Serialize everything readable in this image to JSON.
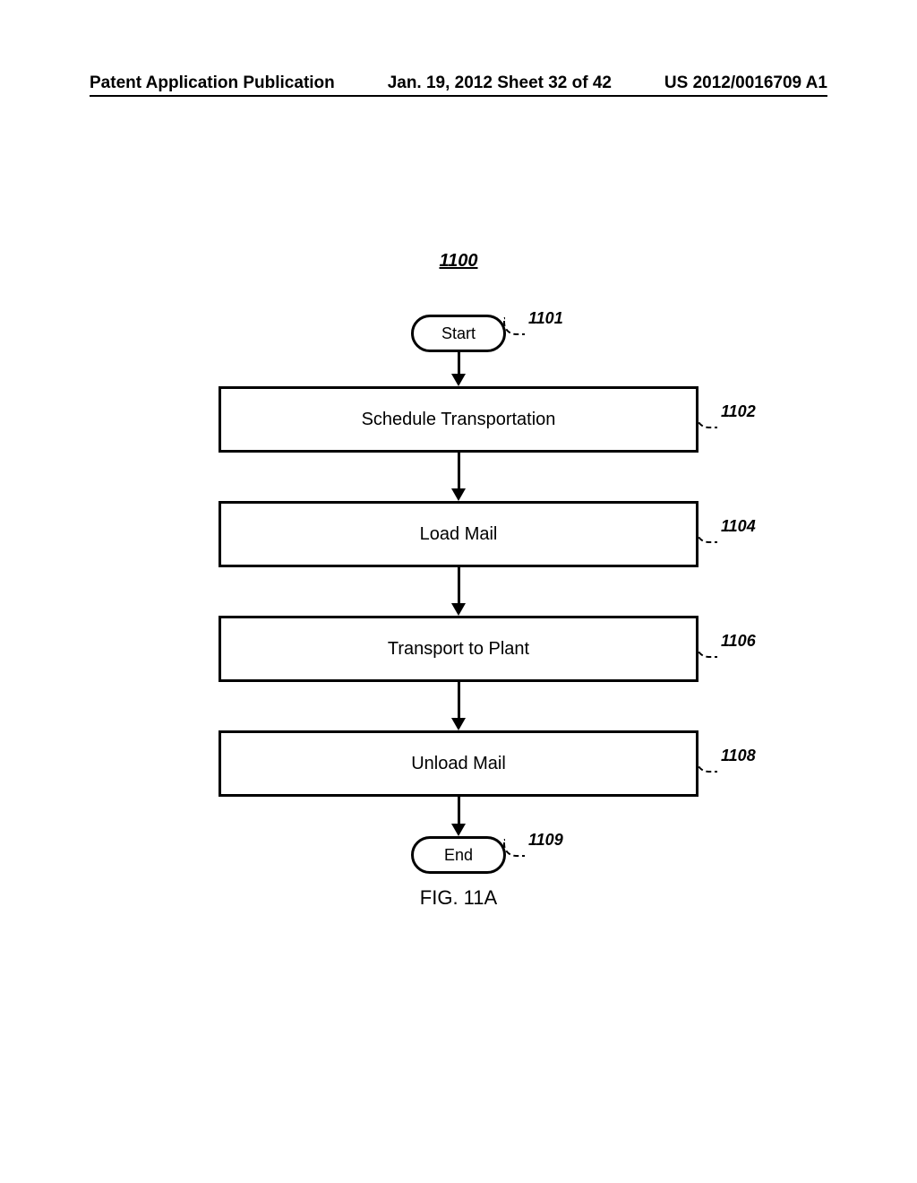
{
  "header": {
    "left": "Patent Application Publication",
    "center": "Jan. 19, 2012  Sheet 32 of 42",
    "right": "US 2012/0016709 A1"
  },
  "diagram": {
    "figure_number": "1100",
    "caption": "FIG. 11A",
    "nodes": {
      "start": {
        "label": "Start",
        "ref": "1101"
      },
      "step1": {
        "label": "Schedule Transportation",
        "ref": "1102"
      },
      "step2": {
        "label": "Load Mail",
        "ref": "1104"
      },
      "step3": {
        "label": "Transport to Plant",
        "ref": "1106"
      },
      "step4": {
        "label": "Unload Mail",
        "ref": "1108"
      },
      "end": {
        "label": "End",
        "ref": "1109"
      }
    }
  }
}
